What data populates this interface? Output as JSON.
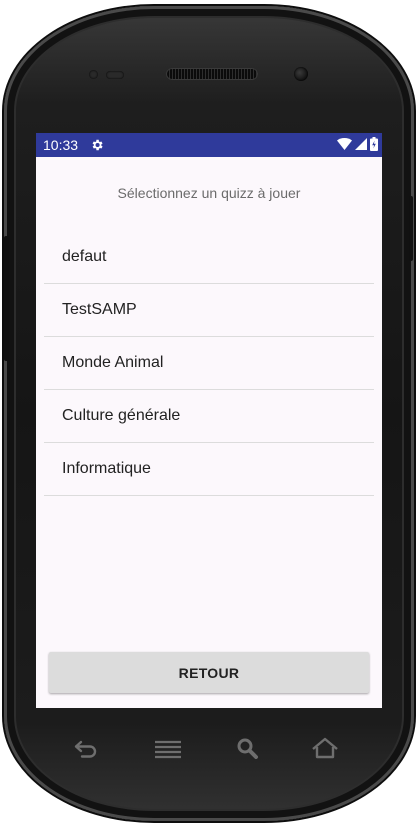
{
  "status_bar": {
    "time": "10:33",
    "background": "#2f3a9b"
  },
  "screen": {
    "prompt": "Sélectionnez un quizz à jouer",
    "quizzes": [
      "defaut",
      "TestSAMP",
      "Monde Animal",
      "Culture générale",
      "Informatique"
    ],
    "back_button": "RETOUR"
  }
}
